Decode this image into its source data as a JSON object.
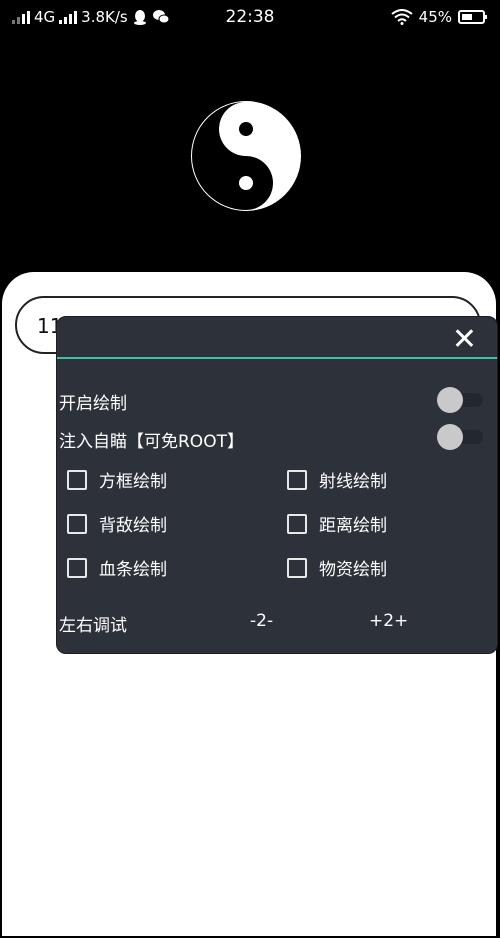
{
  "status_bar": {
    "network": "4G",
    "speed": "3.8K/s",
    "time": "22:38",
    "battery": "45%"
  },
  "background_input": {
    "text": "11"
  },
  "panel": {
    "close_label": "✕",
    "toggles": [
      {
        "label": "开启绘制",
        "on": false
      },
      {
        "label": "注入自瞄【可免ROOT】",
        "on": false
      }
    ],
    "checkboxes": [
      {
        "label": "方框绘制",
        "checked": false
      },
      {
        "label": "射线绘制",
        "checked": false
      },
      {
        "label": "背敌绘制",
        "checked": false
      },
      {
        "label": "距离绘制",
        "checked": false
      },
      {
        "label": "血条绘制",
        "checked": false
      },
      {
        "label": "物资绘制",
        "checked": false
      }
    ],
    "adjust": {
      "label": "左右调试",
      "minus": "-2-",
      "plus": "+2+"
    }
  },
  "colors": {
    "panel_bg": "#2c313a",
    "accent_line": "#3ec1a4"
  }
}
